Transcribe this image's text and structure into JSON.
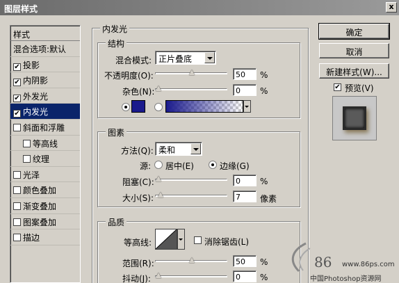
{
  "window": {
    "title": "图层样式",
    "close": "x"
  },
  "styles": {
    "header": "样式",
    "items": [
      {
        "label": "混合选项:默认",
        "checkbox": false,
        "checked": false,
        "selected": false,
        "indent": false
      },
      {
        "label": "投影",
        "checkbox": true,
        "checked": true,
        "selected": false,
        "indent": false
      },
      {
        "label": "内阴影",
        "checkbox": true,
        "checked": true,
        "selected": false,
        "indent": false
      },
      {
        "label": "外发光",
        "checkbox": true,
        "checked": true,
        "selected": false,
        "indent": false
      },
      {
        "label": "内发光",
        "checkbox": true,
        "checked": true,
        "selected": true,
        "indent": false
      },
      {
        "label": "斜面和浮雕",
        "checkbox": true,
        "checked": false,
        "selected": false,
        "indent": false
      },
      {
        "label": "等高线",
        "checkbox": true,
        "checked": false,
        "selected": false,
        "indent": true
      },
      {
        "label": "纹理",
        "checkbox": true,
        "checked": false,
        "selected": false,
        "indent": true
      },
      {
        "label": "光泽",
        "checkbox": true,
        "checked": false,
        "selected": false,
        "indent": false
      },
      {
        "label": "颜色叠加",
        "checkbox": true,
        "checked": false,
        "selected": false,
        "indent": false
      },
      {
        "label": "渐变叠加",
        "checkbox": true,
        "checked": false,
        "selected": false,
        "indent": false
      },
      {
        "label": "图案叠加",
        "checkbox": true,
        "checked": false,
        "selected": false,
        "indent": false
      },
      {
        "label": "描边",
        "checkbox": true,
        "checked": false,
        "selected": false,
        "indent": false
      }
    ]
  },
  "inner_glow": {
    "title": "内发光",
    "structure": {
      "title": "结构",
      "blend_mode_label": "混合模式:",
      "blend_mode_value": "正片叠底",
      "opacity_label": "不透明度(O):",
      "opacity_value": "50",
      "opacity_fraction": 0.5,
      "noise_label": "杂色(N):",
      "noise_value": "0",
      "noise_fraction": 0.0,
      "unit_percent": "%",
      "color": "#1a1a8c"
    },
    "elements": {
      "title": "图素",
      "method_label": "方法(Q):",
      "method_value": "柔和",
      "source_label": "源:",
      "source_center": "居中(E)",
      "source_edge": "边缘(G)",
      "choke_label": "阻塞(C):",
      "choke_value": "0",
      "choke_fraction": 0.0,
      "size_label": "大小(S):",
      "size_value": "7",
      "size_fraction": 0.03,
      "unit_pixels": "像素"
    },
    "quality": {
      "title": "品质",
      "contour_label": "等高线:",
      "antialias_label": "消除锯齿(L)",
      "range_label": "范围(R):",
      "range_value": "50",
      "range_fraction": 0.5,
      "jitter_label": "抖动(J):",
      "jitter_value": "0",
      "jitter_fraction": 0.0
    }
  },
  "buttons": {
    "ok": "确定",
    "cancel": "取消",
    "new_style": "新建样式(W)...",
    "preview": "预览(V)"
  },
  "watermark": {
    "number": "86",
    "url": "www.86ps.com",
    "name": "中国Photoshop资源网"
  }
}
